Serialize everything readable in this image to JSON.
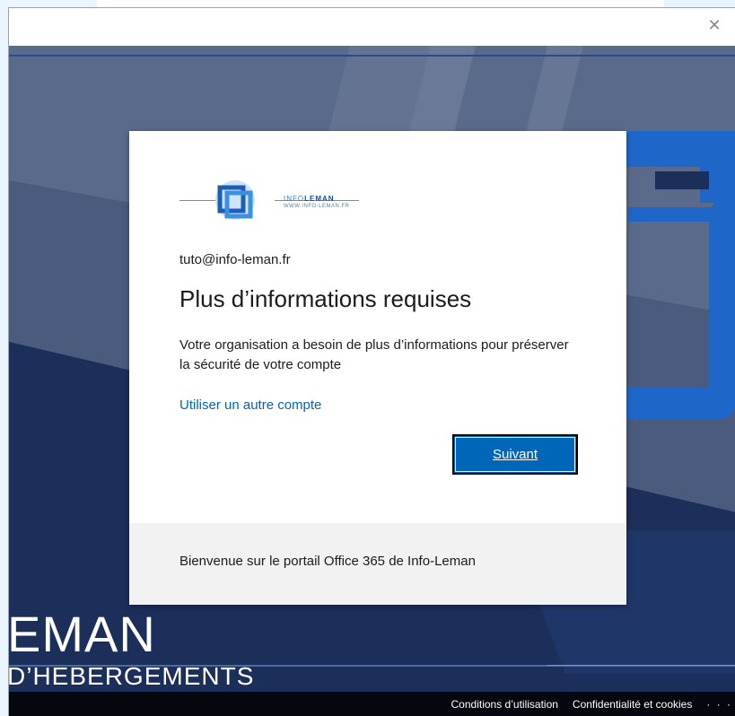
{
  "window": {
    "close_glyph": "✕"
  },
  "background": {
    "brand_big": "EMAN",
    "brand_sub": "D’HEBERGEMENTS"
  },
  "footer": {
    "terms": "Conditions d’utilisation",
    "privacy": "Confidentialité et cookies",
    "more": "· · ·"
  },
  "logo": {
    "name_prefix": "INFO",
    "name_bold": "LEMAN",
    "url": "WWW.INFO-LEMAN.FR",
    "icon": "infoleman-logo-icon"
  },
  "dialog": {
    "email": "tuto@info-leman.fr",
    "title": "Plus d’informations requises",
    "description": "Votre organisation a besoin de plus d’informations pour préserver la sécurité de votre compte",
    "other_account_link": "Utiliser un autre compte",
    "next_button": "Suivant",
    "welcome": "Bienvenue sur le portail Office 365 de Info-Leman"
  },
  "colors": {
    "accent": "#0067b8",
    "background_dark": "#1c2f5a",
    "footer_panel": "#f2f2f2"
  }
}
